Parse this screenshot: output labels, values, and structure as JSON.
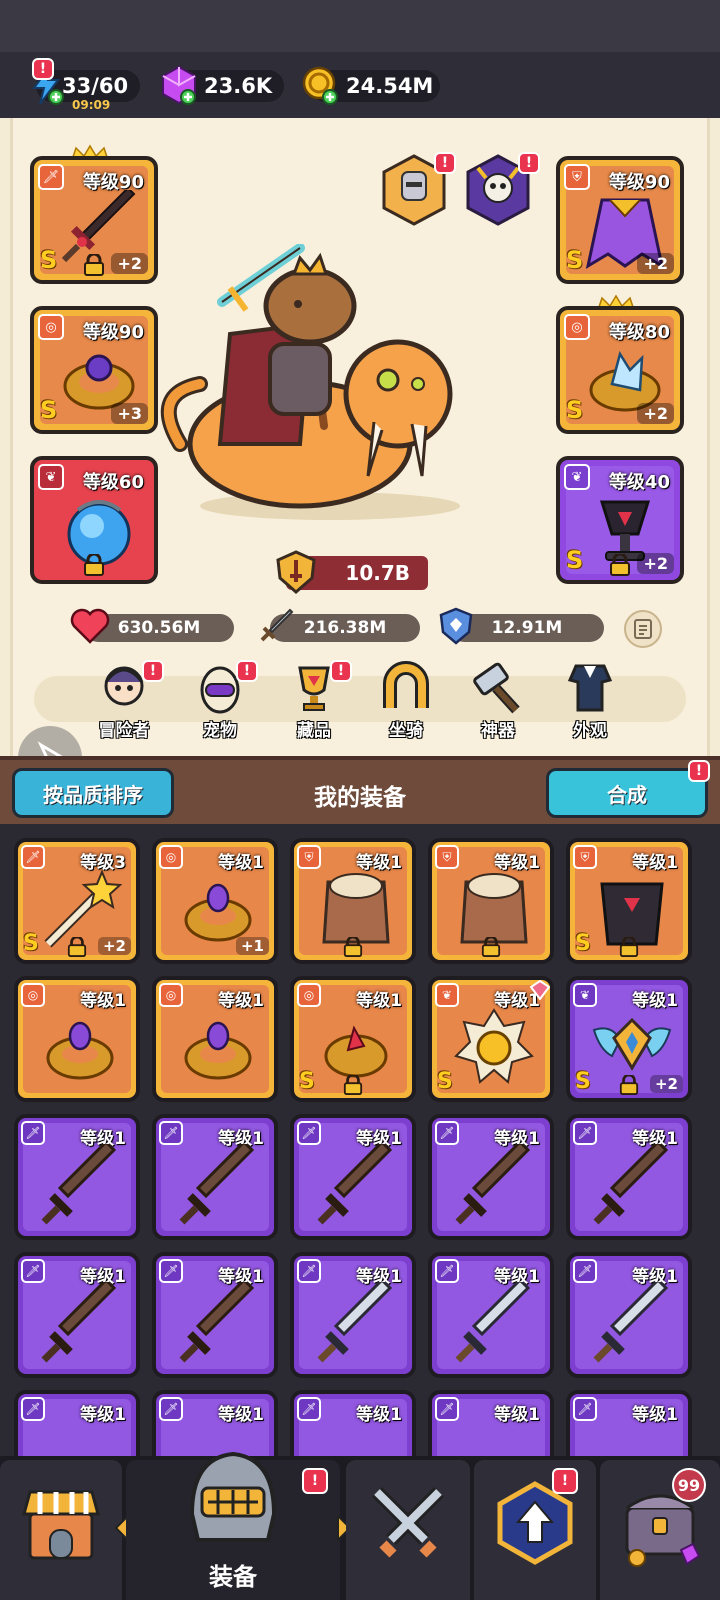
{
  "resources": {
    "energy": "33/60",
    "energy_timer": "09:09",
    "gems": "23.6K",
    "gold": "24.54M"
  },
  "hero_slots": {
    "weapon": {
      "level": "等级90",
      "grade": "S",
      "plus": "+2"
    },
    "ring": {
      "level": "等级90",
      "grade": "S",
      "plus": "+3"
    },
    "necklace": {
      "level": "等级60"
    },
    "armor": {
      "level": "等级90",
      "grade": "S",
      "plus": "+2"
    },
    "bracer": {
      "level": "等级80",
      "grade": "S",
      "plus": "+2"
    },
    "relic": {
      "level": "等级40",
      "grade": "S",
      "plus": "+2"
    }
  },
  "power": "10.7B",
  "stats": {
    "hp": "630.56M",
    "attack": "216.38M",
    "defense": "12.91M"
  },
  "tabs": [
    {
      "label": "冒险者"
    },
    {
      "label": "宠物"
    },
    {
      "label": "藏品"
    },
    {
      "label": "坐骑"
    },
    {
      "label": "神器"
    },
    {
      "label": "外观"
    }
  ],
  "equip": {
    "sort_label": "按品质排序",
    "title": "我的装备",
    "synth_label": "合成"
  },
  "grid": [
    {
      "level": "等级3",
      "grade": "S",
      "plus": "+2"
    },
    {
      "level": "等级1",
      "grade": "",
      "plus": "+1"
    },
    {
      "level": "等级1"
    },
    {
      "level": "等级1"
    },
    {
      "level": "等级1",
      "grade": "S"
    },
    {
      "level": "等级1"
    },
    {
      "level": "等级1"
    },
    {
      "level": "等级1",
      "grade": "S"
    },
    {
      "level": "等级1",
      "grade": "S"
    },
    {
      "level": "等级1",
      "grade": "S",
      "plus": "+2"
    },
    {
      "level": "等级1"
    },
    {
      "level": "等级1"
    },
    {
      "level": "等级1"
    },
    {
      "level": "等级1"
    },
    {
      "level": "等级1"
    },
    {
      "level": "等级1"
    },
    {
      "level": "等级1"
    },
    {
      "level": "等级1"
    },
    {
      "level": "等级1"
    },
    {
      "level": "等级1"
    },
    {
      "level": "等级1"
    },
    {
      "level": "等级1"
    },
    {
      "level": "等级1"
    },
    {
      "level": "等级1"
    },
    {
      "level": "等级1"
    }
  ],
  "bottom_nav": {
    "active_label": "装备",
    "chest_count": "99"
  },
  "colors": {
    "orange_frame": "#f4b53a",
    "purple_frame": "#8f49e0",
    "red_frame": "#e7434e",
    "badge": "#e9334f",
    "cyan_button": "#39b3d8"
  }
}
